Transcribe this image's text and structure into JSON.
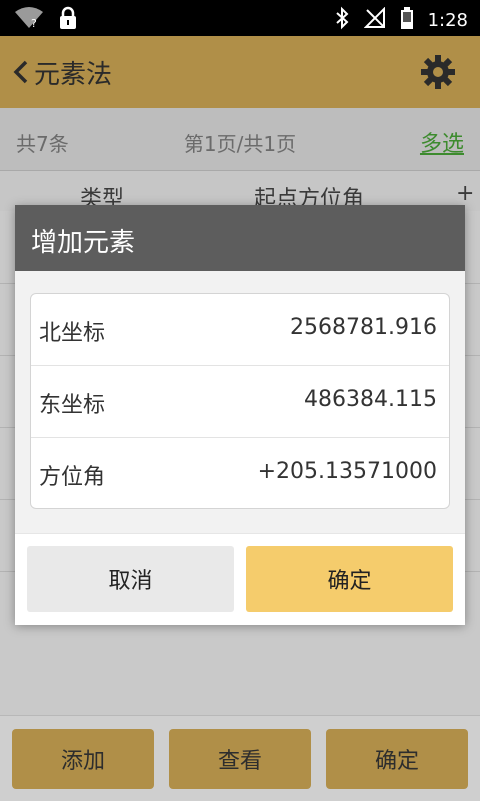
{
  "status_bar": {
    "time": "1:28",
    "icons": [
      "wifi-question-icon",
      "lock-icon",
      "bluetooth-icon",
      "no-signal-icon",
      "battery-icon"
    ]
  },
  "app_bar": {
    "title": "元素法",
    "back_icon": "chevron-left-icon",
    "settings_icon": "gear-icon",
    "bar_color": "#b08f48"
  },
  "info_bar": {
    "count": "共7条",
    "page": "第1页/共1页",
    "multi_select": "多选"
  },
  "table": {
    "headers": [
      "类型",
      "起点方位角",
      "+"
    ]
  },
  "dialog": {
    "title": "增加元素",
    "fields": [
      {
        "label": "北坐标",
        "value": "2568781.916"
      },
      {
        "label": "东坐标",
        "value": "486384.115"
      },
      {
        "label": "方位角",
        "value": "+205.13571000"
      }
    ],
    "cancel": "取消",
    "confirm": "确定",
    "confirm_color": "#f5cc6c"
  },
  "bottom_bar": {
    "add": "添加",
    "view": "查看",
    "confirm": "确定"
  }
}
